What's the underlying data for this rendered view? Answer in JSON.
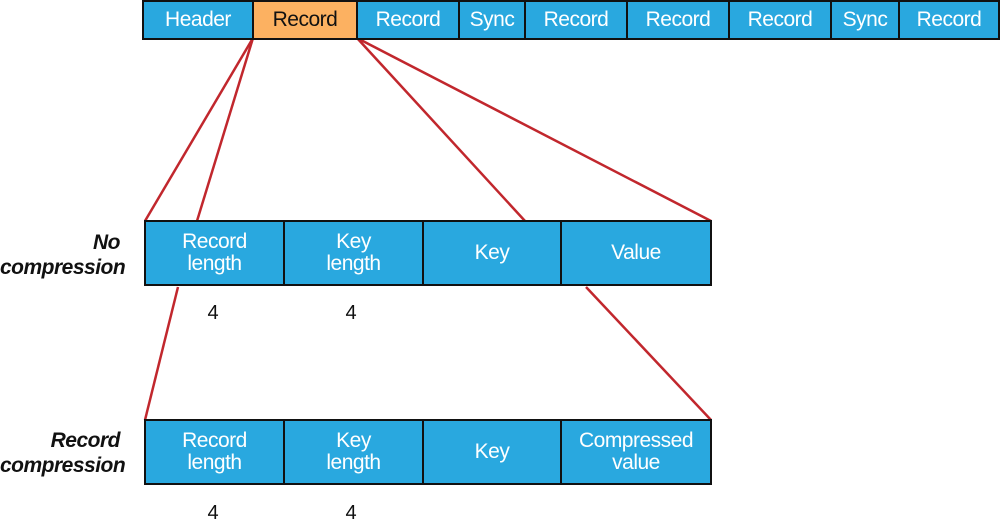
{
  "colors": {
    "cell_fill": "#29a8df",
    "highlight_fill": "#fcb161",
    "connector": "#c1272d",
    "border": "#111111"
  },
  "file_layout": {
    "cells": [
      {
        "label": "Header",
        "highlight": false
      },
      {
        "label": "Record",
        "highlight": true
      },
      {
        "label": "Record",
        "highlight": false
      },
      {
        "label": "Sync",
        "highlight": false
      },
      {
        "label": "Record",
        "highlight": false
      },
      {
        "label": "Record",
        "highlight": false
      },
      {
        "label": "Record",
        "highlight": false
      },
      {
        "label": "Sync",
        "highlight": false
      },
      {
        "label": "Record",
        "highlight": false
      }
    ]
  },
  "rows": [
    {
      "label": "No\ncompression",
      "cells": [
        "Record\nlength",
        "Key\nlength",
        "Key",
        "Value"
      ],
      "sizes": [
        "4",
        "4"
      ]
    },
    {
      "label": "Record\ncompression",
      "cells": [
        "Record\nlength",
        "Key\nlength",
        "Key",
        "Compressed\nvalue"
      ],
      "sizes": [
        "4",
        "4"
      ]
    }
  ]
}
